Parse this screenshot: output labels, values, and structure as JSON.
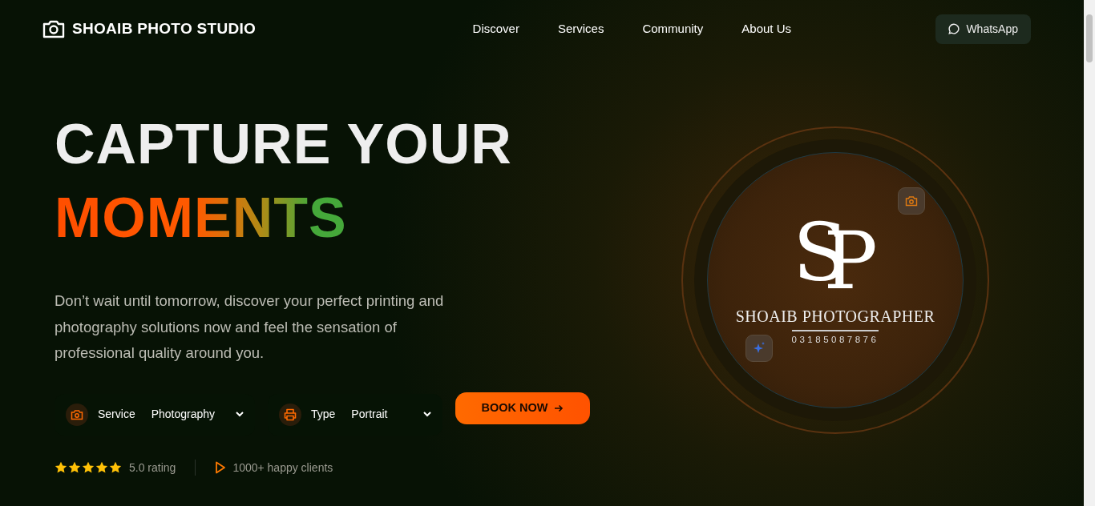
{
  "brand": {
    "name": "SHOAIB PHOTO STUDIO"
  },
  "nav": [
    {
      "label": "Discover"
    },
    {
      "label": "Services"
    },
    {
      "label": "Community"
    },
    {
      "label": "About Us"
    }
  ],
  "whatsapp": {
    "label": "WhatsApp"
  },
  "headline": {
    "line_1": "CAPTURE YOUR",
    "line_2": "MOMENTS"
  },
  "intro": "Don’t wait until tomorrow, discover your perfect printing and photography solutions now and feel the sensation of professional quality around you.",
  "selectors": [
    {
      "kind": "camera",
      "label": "Service",
      "value": "Photography"
    },
    {
      "kind": "printer",
      "label": "Type",
      "value": "Portrait"
    }
  ],
  "book_button": {
    "label": "BOOK NOW"
  },
  "rating": {
    "stars": 5,
    "text": "5.0 rating"
  },
  "clients": {
    "text": "1000+ happy clients"
  },
  "logo": {
    "monogram_1": "S",
    "monogram_2": "P",
    "name": "SHOAIB PHOTOGRAPHER",
    "phone": "03185087876"
  }
}
